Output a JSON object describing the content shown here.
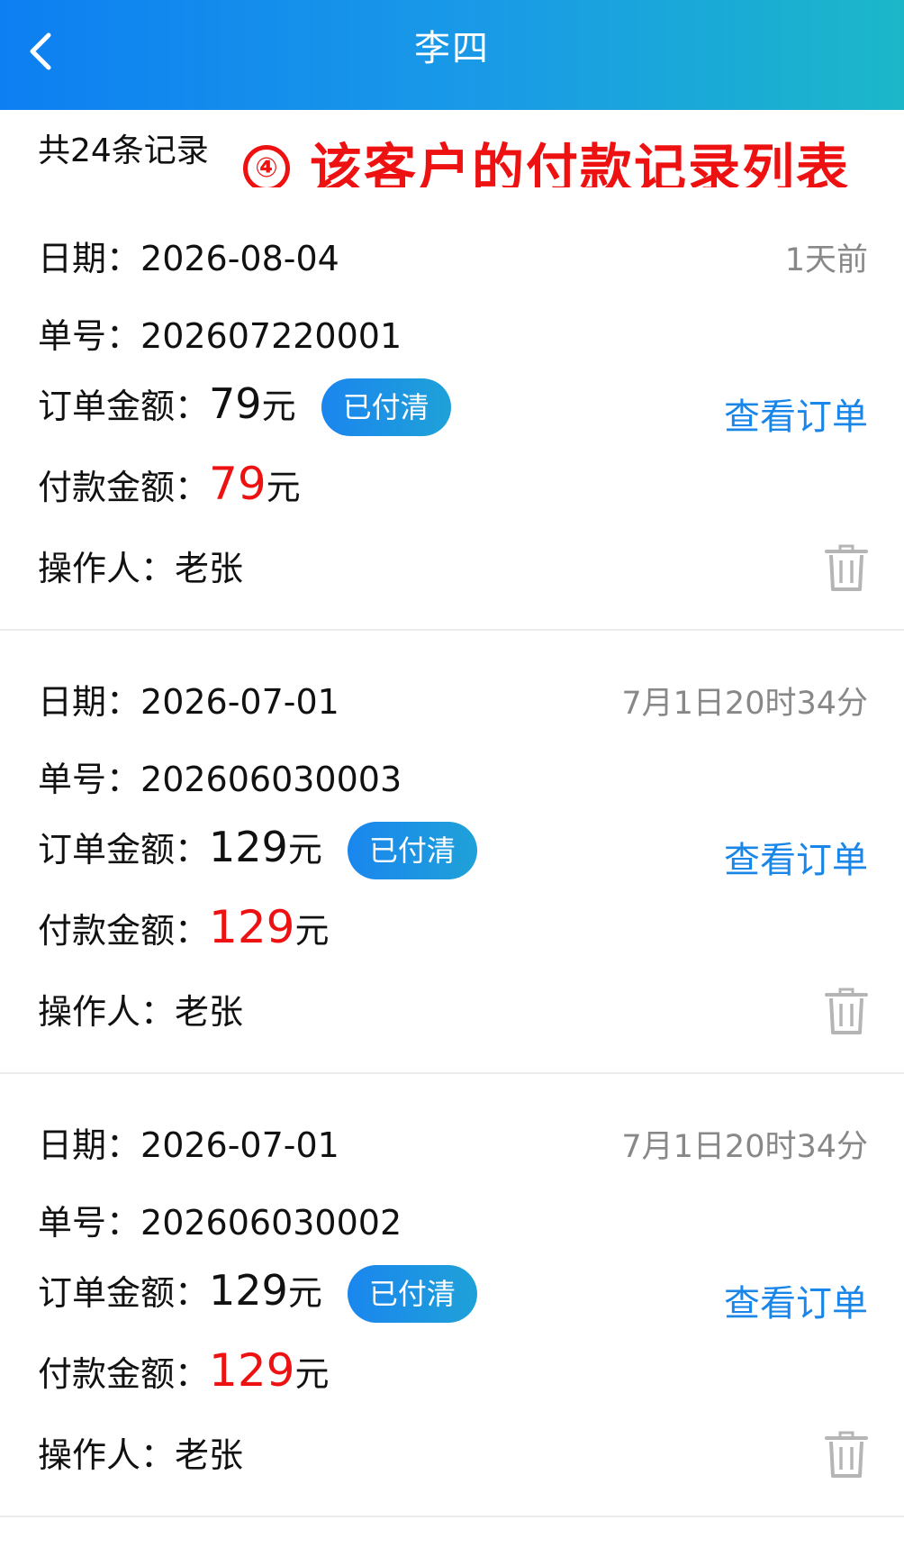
{
  "header": {
    "title": "李四",
    "back_icon": "chevron-left-icon"
  },
  "summary": {
    "count_text": "共24条记录"
  },
  "annotation": {
    "marker": "④",
    "text": "该客户的付款记录列表",
    "color": "#ee1111"
  },
  "labels": {
    "date": "日期：",
    "order_no": "单号：",
    "order_amount": "订单金额：",
    "payment_amount": "付款金额：",
    "operator": "操作人：",
    "unit": "元",
    "view_order": "查看订单"
  },
  "records": [
    {
      "date": "2026-08-04",
      "time_ago": "1天前",
      "order_no": "202607220001",
      "order_amount": "79",
      "status": "已付清",
      "payment_amount": "79",
      "operator": "老张"
    },
    {
      "date": "2026-07-01",
      "time_ago": "7月1日20时34分",
      "order_no": "202606030003",
      "order_amount": "129",
      "status": "已付清",
      "payment_amount": "129",
      "operator": "老张"
    },
    {
      "date": "2026-07-01",
      "time_ago": "7月1日20时34分",
      "order_no": "202606030002",
      "order_amount": "129",
      "status": "已付清",
      "payment_amount": "129",
      "operator": "老张"
    }
  ],
  "colors": {
    "header_start": "#0d7ff2",
    "header_end": "#1bb7c9",
    "accent": "#1a86e8",
    "highlight": "#ee1111",
    "muted": "#888888"
  }
}
